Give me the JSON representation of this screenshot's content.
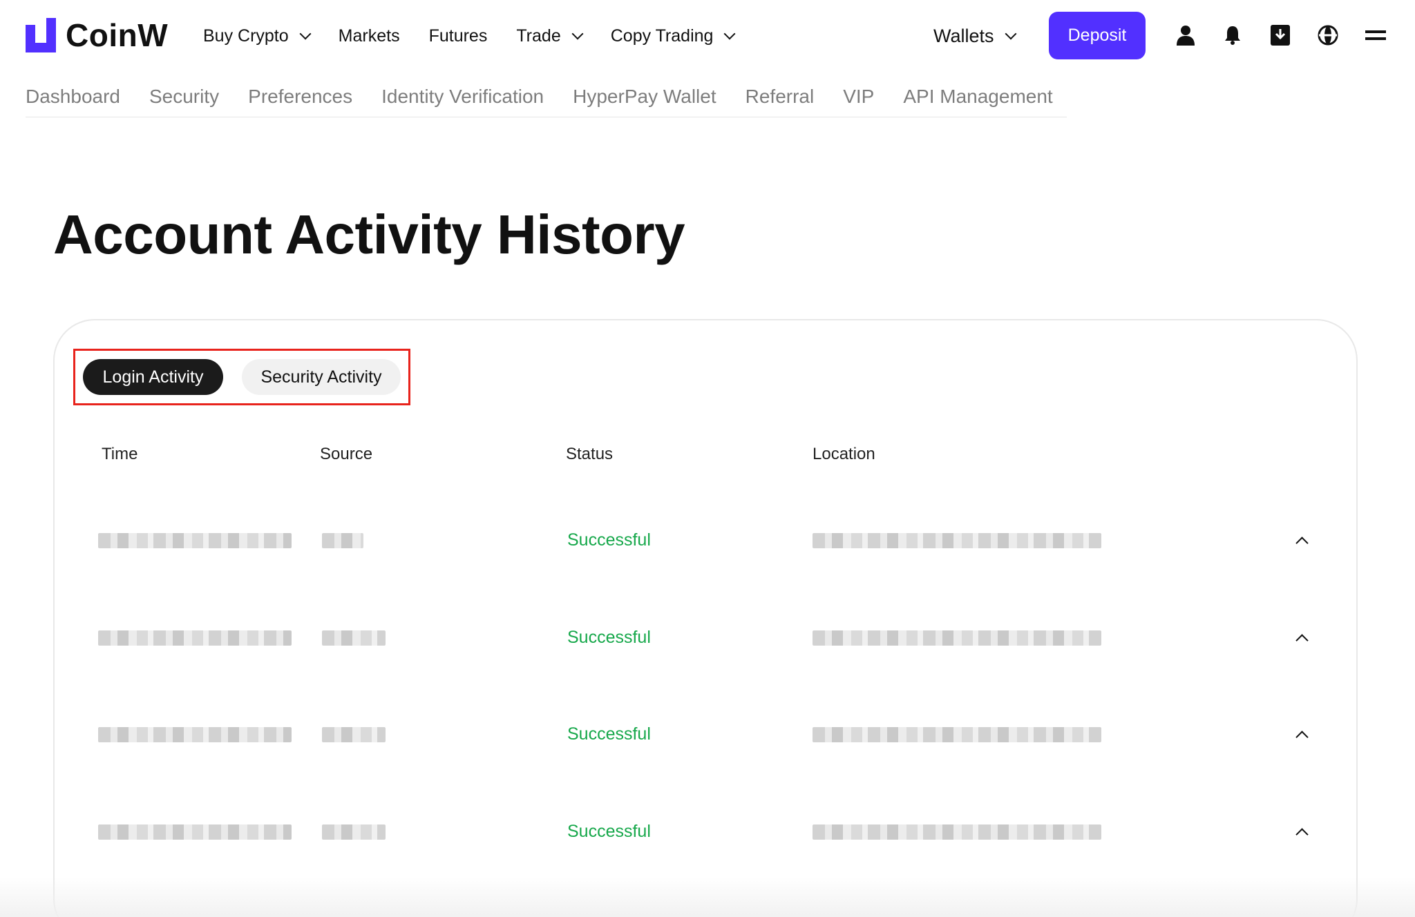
{
  "brand": {
    "name": "CoinW",
    "accent": "#5230ff"
  },
  "nav": {
    "items": [
      {
        "label": "Buy Crypto",
        "has_dropdown": true
      },
      {
        "label": "Markets",
        "has_dropdown": false
      },
      {
        "label": "Futures",
        "has_dropdown": false
      },
      {
        "label": "Trade",
        "has_dropdown": true
      },
      {
        "label": "Copy Trading",
        "has_dropdown": true
      }
    ],
    "wallets_label": "Wallets",
    "deposit_label": "Deposit",
    "icons": [
      "user-icon",
      "bell-icon",
      "download-icon",
      "globe-icon",
      "menu-icon"
    ]
  },
  "subnav": {
    "items": [
      "Dashboard",
      "Security",
      "Preferences",
      "Identity Verification",
      "HyperPay Wallet",
      "Referral",
      "VIP",
      "API Management"
    ]
  },
  "page": {
    "title": "Account Activity History"
  },
  "tabs": {
    "login": "Login Activity",
    "security": "Security Activity",
    "active": "login"
  },
  "table": {
    "headers": {
      "time": "Time",
      "source": "Source",
      "status": "Status",
      "location": "Location"
    },
    "rows": [
      {
        "status": "Successful"
      },
      {
        "status": "Successful"
      },
      {
        "status": "Successful"
      },
      {
        "status": "Successful"
      }
    ],
    "status_color": "#17a84b"
  }
}
